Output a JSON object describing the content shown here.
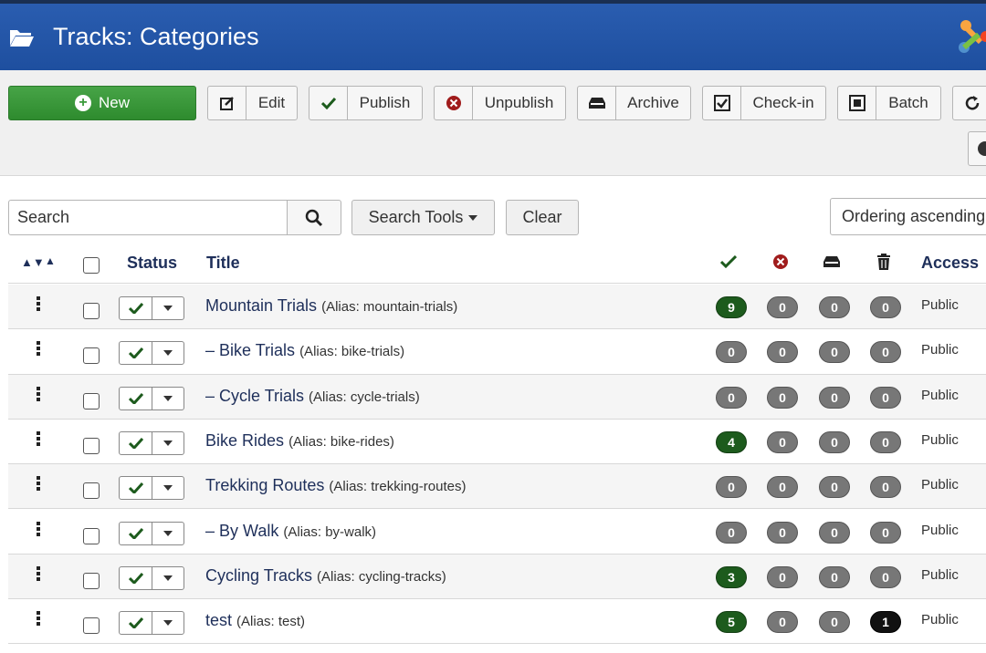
{
  "header": {
    "title": "Tracks: Categories",
    "icon": "folder-open-icon",
    "logo": "joomla-logo"
  },
  "toolbar": {
    "new_label": "New",
    "edit_label": "Edit",
    "publish_label": "Publish",
    "unpublish_label": "Unpublish",
    "archive_label": "Archive",
    "checkin_label": "Check-in",
    "batch_label": "Batch"
  },
  "filters": {
    "search_placeholder": "Search",
    "search_tools_label": "Search Tools",
    "clear_label": "Clear",
    "ordering_value": "Ordering ascending"
  },
  "table": {
    "headers": {
      "status": "Status",
      "title": "Title",
      "access": "Access"
    },
    "rows": [
      {
        "indent": "",
        "title": "Mountain Trials",
        "alias": "(Alias: mountain-trials)",
        "published": "9",
        "unpublished": "0",
        "archived": "0",
        "trashed": "0",
        "access": "Public"
      },
      {
        "indent": "– ",
        "title": "Bike Trials",
        "alias": "(Alias: bike-trials)",
        "published": "0",
        "unpublished": "0",
        "archived": "0",
        "trashed": "0",
        "access": "Public"
      },
      {
        "indent": "– ",
        "title": "Cycle Trials",
        "alias": "(Alias: cycle-trials)",
        "published": "0",
        "unpublished": "0",
        "archived": "0",
        "trashed": "0",
        "access": "Public"
      },
      {
        "indent": "",
        "title": "Bike Rides",
        "alias": "(Alias: bike-rides)",
        "published": "4",
        "unpublished": "0",
        "archived": "0",
        "trashed": "0",
        "access": "Public"
      },
      {
        "indent": "",
        "title": "Trekking Routes",
        "alias": "(Alias: trekking-routes)",
        "published": "0",
        "unpublished": "0",
        "archived": "0",
        "trashed": "0",
        "access": "Public"
      },
      {
        "indent": "– ",
        "title": "By Walk",
        "alias": "(Alias: by-walk)",
        "published": "0",
        "unpublished": "0",
        "archived": "0",
        "trashed": "0",
        "access": "Public"
      },
      {
        "indent": "",
        "title": "Cycling Tracks",
        "alias": "(Alias: cycling-tracks)",
        "published": "3",
        "unpublished": "0",
        "archived": "0",
        "trashed": "0",
        "access": "Public"
      },
      {
        "indent": "",
        "title": "test",
        "alias": "(Alias: test)",
        "published": "5",
        "unpublished": "0",
        "archived": "0",
        "trashed": "1",
        "access": "Public"
      }
    ]
  },
  "colors": {
    "header_bg": "#1e4f9f",
    "new_button": "#3a9a3a",
    "published_badge": "#1d5b1d",
    "trashed_badge": "#111111",
    "zero_badge": "#777777"
  }
}
